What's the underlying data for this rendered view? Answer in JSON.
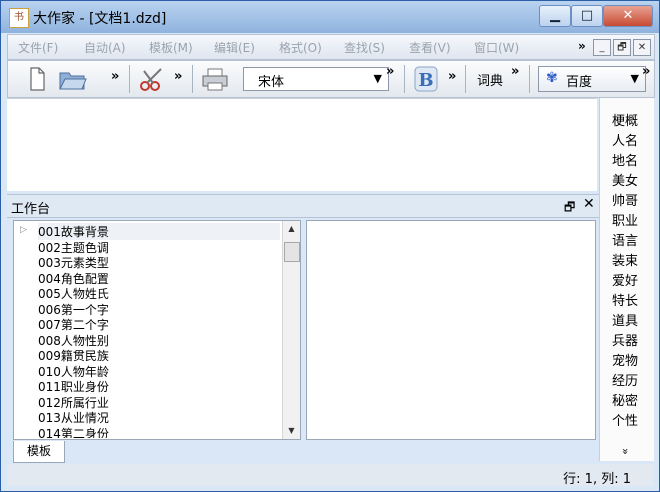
{
  "window": {
    "title": "大作家 - [文档1.dzd]",
    "app_icon_text": "书"
  },
  "window_controls": {
    "minimize": "▁",
    "maximize": "□",
    "close": "✕"
  },
  "menu": {
    "items": [
      "文件(F)",
      "自动(A)",
      "模板(M)",
      "编辑(E)",
      "格式(O)",
      "查找(S)",
      "查看(V)",
      "窗口(W)"
    ],
    "overflow": "»",
    "mdi_min": "_",
    "mdi_restore": "🗗",
    "mdi_close": "✕"
  },
  "toolbar": {
    "overflow": "»",
    "font_name": "宋体",
    "dict_label": "词典",
    "search_engine": "百度",
    "search_engine_icon": "paw-icon"
  },
  "side_panel": {
    "items": [
      "梗概",
      "人名",
      "地名",
      "美女",
      "帅哥",
      "职业",
      "语言",
      "装束",
      "爱好",
      "特长",
      "道具",
      "兵器",
      "宠物",
      "经历",
      "秘密",
      "个性"
    ],
    "more": "»"
  },
  "workbench": {
    "title": "工作台",
    "restore": "🗗",
    "close": "✕"
  },
  "tree": {
    "items": [
      "001故事背景",
      "002主题色调",
      "003元素类型",
      "004角色配置",
      "005人物姓氏",
      "006第一个字",
      "007第二个字",
      "008人物性别",
      "009籍贯民族",
      "010人物年龄",
      "011职业身份",
      "012所属行业",
      "013从业情况",
      "014第二身份"
    ]
  },
  "tabs": {
    "template": "模板"
  },
  "status": {
    "text": "行: 1, 列: 1"
  }
}
